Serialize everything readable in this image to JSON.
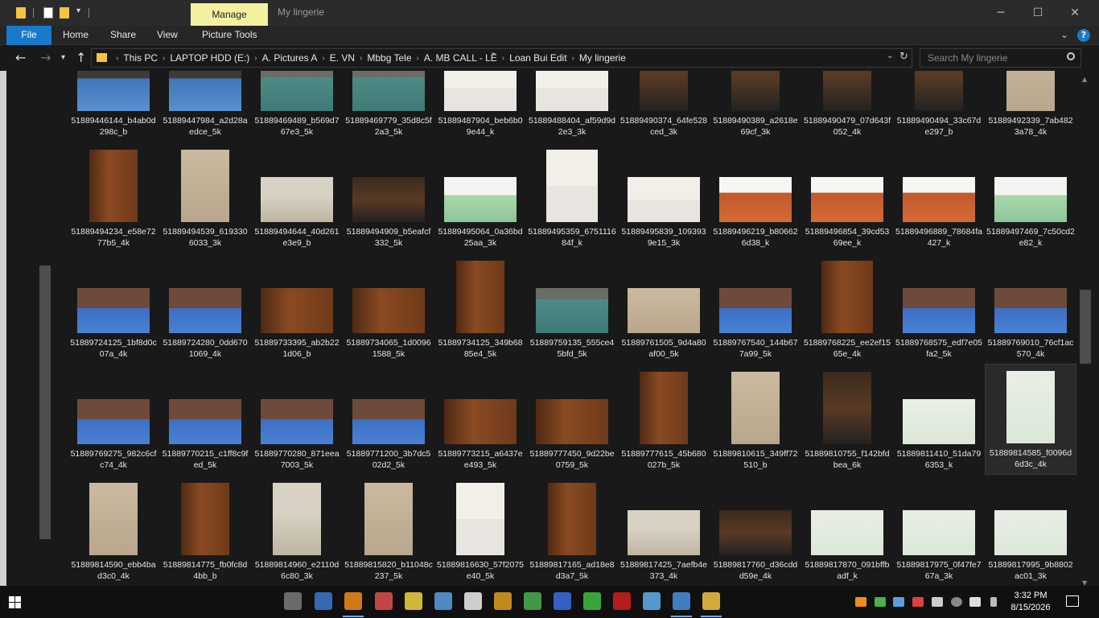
{
  "titlebar": {
    "manage_tab": "Manage",
    "window_title": "My lingerie",
    "minimize": "─",
    "maximize": "☐",
    "close": "✕"
  },
  "ribbon": {
    "tabs": [
      "File",
      "Home",
      "Share",
      "View",
      "Picture Tools"
    ]
  },
  "address": {
    "crumbs": [
      "This PC",
      "LAPTOP HDD (E:)",
      "A. Pictures A",
      "E. VN",
      "Mbbg Tele",
      "A. MB CALL - LỀ",
      "Loan Bui Edit",
      "My lingerie"
    ],
    "search_placeholder": "Search My lingerie"
  },
  "files": [
    {
      "name": "51889446144_b4ab0d298c_b",
      "style": "t-blue",
      "shape": "land"
    },
    {
      "name": "51889447984_a2d28aedce_5k",
      "style": "t-blue",
      "shape": "land"
    },
    {
      "name": "51889469489_b569d767e3_5k",
      "style": "t-teal",
      "shape": "land"
    },
    {
      "name": "51889469779_35d8c5f2a3_5k",
      "style": "t-teal",
      "shape": "land"
    },
    {
      "name": "51889487904_beb6b09e44_k",
      "style": "t-red",
      "shape": "land"
    },
    {
      "name": "51889488404_af59d9d2e3_3k",
      "style": "t-red",
      "shape": "land"
    },
    {
      "name": "51889490374_64fe528ced_3k",
      "style": "t-dark",
      "shape": "port"
    },
    {
      "name": "51889490389_a2618e69cf_3k",
      "style": "t-dark",
      "shape": "port"
    },
    {
      "name": "51889490479_07d643f052_4k",
      "style": "t-dark",
      "shape": "port"
    },
    {
      "name": "51889490494_33c67de297_b",
      "style": "t-dark",
      "shape": "port"
    },
    {
      "name": "51889492339_7ab4823a78_4k",
      "style": "t-beige",
      "shape": "port"
    },
    {
      "name": "51889494234_e58e7277b5_4k",
      "style": "t-wood",
      "shape": "port"
    },
    {
      "name": "51889494539_6193306033_3k",
      "style": "t-beige",
      "shape": "port"
    },
    {
      "name": "51889494644_40d261e3e9_b",
      "style": "t-sofa",
      "shape": "land"
    },
    {
      "name": "51889494909_b5eafcf332_5k",
      "style": "t-dark",
      "shape": "land"
    },
    {
      "name": "51889495064_0a36bd25aa_3k",
      "style": "t-mint",
      "shape": "land"
    },
    {
      "name": "51889495359_675111684f_k",
      "style": "t-red",
      "shape": "tall"
    },
    {
      "name": "51889495839_1093939e15_3k",
      "style": "t-red",
      "shape": "land"
    },
    {
      "name": "51889496219_b806626d38_k",
      "style": "t-orange",
      "shape": "land"
    },
    {
      "name": "51889496854_39cd5369ee_k",
      "style": "t-orange",
      "shape": "land"
    },
    {
      "name": "51889496889_78684fa427_k",
      "style": "t-orange",
      "shape": "land"
    },
    {
      "name": "51889497469_7c50cd2e82_k",
      "style": "t-mint",
      "shape": "land"
    },
    {
      "name": "51889724125_1bf8d0c07a_4k",
      "style": "t-curtain",
      "shape": "land"
    },
    {
      "name": "51889724280_0dd6701069_4k",
      "style": "t-curtain",
      "shape": "land"
    },
    {
      "name": "51889733395_ab2b221d06_b",
      "style": "t-wood",
      "shape": "land"
    },
    {
      "name": "51889734065_1d00961588_5k",
      "style": "t-wood",
      "shape": "land"
    },
    {
      "name": "51889734125_349b6885e4_5k",
      "style": "t-wood",
      "shape": "port"
    },
    {
      "name": "51889759135_555ce45bfd_5k",
      "style": "t-teal",
      "shape": "land"
    },
    {
      "name": "51889761505_9d4a80af00_5k",
      "style": "t-beige",
      "shape": "land"
    },
    {
      "name": "51889767540_144b677a99_5k",
      "style": "t-curtain",
      "shape": "land"
    },
    {
      "name": "51889768225_ee2ef1565e_4k",
      "style": "t-wood",
      "shape": "tall"
    },
    {
      "name": "51889768575_edf7e05fa2_5k",
      "style": "t-curtain",
      "shape": "land"
    },
    {
      "name": "51889769010_76cf1ac570_4k",
      "style": "t-curtain",
      "shape": "land"
    },
    {
      "name": "51889769275_982c6cfc74_4k",
      "style": "t-curtain",
      "shape": "land"
    },
    {
      "name": "51889770215_c1ff8c9fed_5k",
      "style": "t-curtain",
      "shape": "land"
    },
    {
      "name": "51889770280_871eea7003_5k",
      "style": "t-curtain",
      "shape": "land"
    },
    {
      "name": "51889771200_3b7dc502d2_5k",
      "style": "t-curtain",
      "shape": "land"
    },
    {
      "name": "51889773215_a6437ee493_5k",
      "style": "t-wood",
      "shape": "land"
    },
    {
      "name": "51889777450_9d22be0759_5k",
      "style": "t-wood",
      "shape": "land"
    },
    {
      "name": "51889777615_45b680027b_5k",
      "style": "t-wood",
      "shape": "port"
    },
    {
      "name": "51889810615_349ff72510_b",
      "style": "t-beige",
      "shape": "port"
    },
    {
      "name": "51889810755_f142bfdbea_6k",
      "style": "t-dark",
      "shape": "port"
    },
    {
      "name": "51889811410_51da796353_k",
      "style": "t-green",
      "shape": "land"
    },
    {
      "name": "51889814585_f0096d6d3c_4k",
      "style": "t-green",
      "shape": "port",
      "selected": true
    },
    {
      "name": "51889814590_ebb4bad3c0_4k",
      "style": "t-beige",
      "shape": "port"
    },
    {
      "name": "51889814775_fb0fc8d4bb_b",
      "style": "t-wood",
      "shape": "port"
    },
    {
      "name": "51889814960_e2110d6c80_3k",
      "style": "t-sofa",
      "shape": "port"
    },
    {
      "name": "51889815820_b11048c237_5k",
      "style": "t-beige",
      "shape": "port"
    },
    {
      "name": "51889816630_57f2075e40_5k",
      "style": "t-red",
      "shape": "port"
    },
    {
      "name": "51889817165_ad18e8d3a7_5k",
      "style": "t-wood",
      "shape": "port"
    },
    {
      "name": "51889817425_7aefb4e373_4k",
      "style": "t-sofa",
      "shape": "land"
    },
    {
      "name": "51889817760_d36cddd59e_4k",
      "style": "t-dark",
      "shape": "land"
    },
    {
      "name": "51889817870_091bffbadf_k",
      "style": "t-green",
      "shape": "land"
    },
    {
      "name": "51889817975_0f47fe767a_3k",
      "style": "t-green",
      "shape": "land"
    },
    {
      "name": "51889817995_9b8802ac01_3k",
      "style": "t-green",
      "shape": "land"
    }
  ],
  "taskbar": {
    "apps": [
      {
        "name": "task-view-app",
        "color": "#7a7a7a"
      },
      {
        "name": "text-editor-app",
        "color": "#3a7ad0"
      },
      {
        "name": "search-app",
        "color": "#f28c1a"
      },
      {
        "name": "mail-app",
        "color": "#e05050"
      },
      {
        "name": "sticky-notes-app",
        "color": "#f5d442"
      },
      {
        "name": "cloud-app",
        "color": "#5aa0e0"
      },
      {
        "name": "shirt-app",
        "color": "#f0f0f0"
      },
      {
        "name": "settings-app",
        "color": "#e0a020"
      },
      {
        "name": "globe-app",
        "color": "#4ab050"
      },
      {
        "name": "checkbox-app",
        "color": "#3a70e0"
      },
      {
        "name": "clover-app",
        "color": "#40c040"
      },
      {
        "name": "cherry-app",
        "color": "#d02020"
      },
      {
        "name": "star-app",
        "color": "#60b0f0"
      },
      {
        "name": "chrome-app",
        "color": "#4a90e0"
      },
      {
        "name": "file-explorer-app",
        "color": "#f5c542"
      }
    ],
    "time": "3:32 PM",
    "date": "8/15/2026"
  }
}
